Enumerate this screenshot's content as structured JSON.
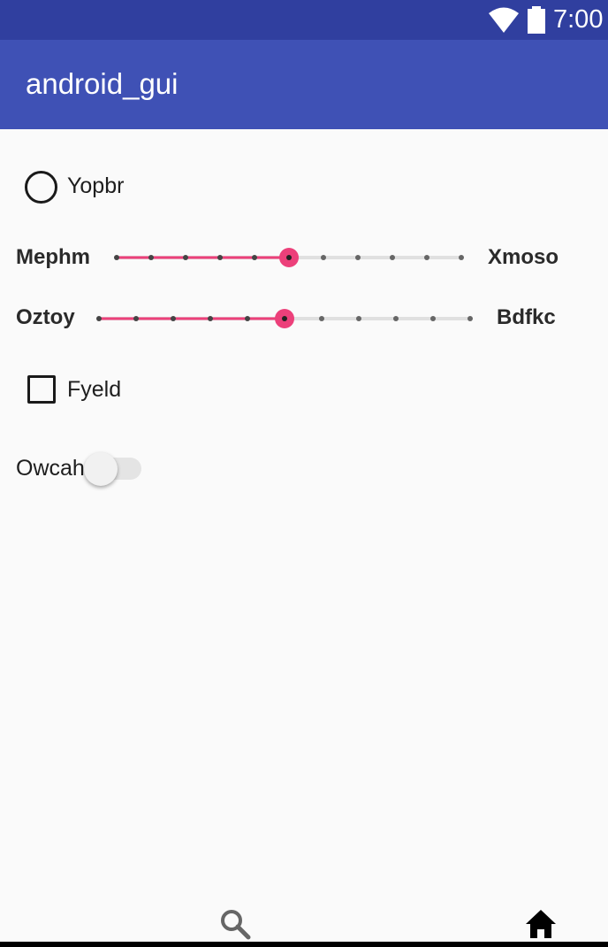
{
  "status_bar": {
    "time": "7:00",
    "icons": [
      "wifi-icon",
      "battery-icon"
    ]
  },
  "app_bar": {
    "title": "android_gui"
  },
  "radio": {
    "label": "Yopbr",
    "checked": false
  },
  "sliders": [
    {
      "min_label": "Mephm",
      "max_label": "Xmoso",
      "value": 5,
      "max": 10,
      "accent": "#ec407a"
    },
    {
      "min_label": "Oztoy",
      "max_label": "Bdfkc",
      "value": 5,
      "max": 10,
      "accent": "#ec407a"
    }
  ],
  "checkbox": {
    "label": "Fyeld",
    "checked": false
  },
  "switch": {
    "label": "Owcah",
    "on": false
  },
  "bottom_nav": {
    "icons": [
      "search-icon",
      "home-icon"
    ]
  },
  "colors": {
    "status_bar": "#303f9f",
    "app_bar": "#3f51b5",
    "accent": "#ec407a"
  }
}
